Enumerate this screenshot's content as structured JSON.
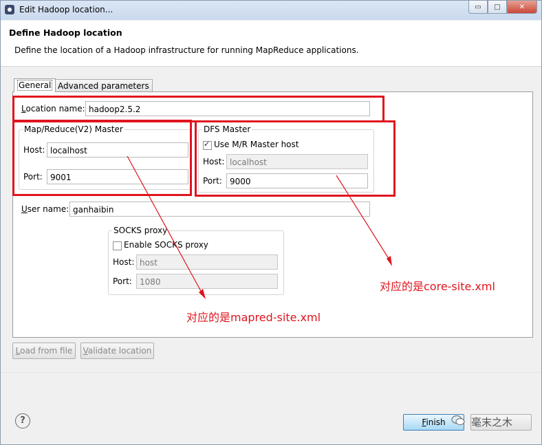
{
  "window": {
    "title": "Edit Hadoop location...",
    "buttons": {
      "minimize": "▭",
      "maximize": "□",
      "close": "✕"
    }
  },
  "header": {
    "title": "Define Hadoop location",
    "description": "Define the location of a Hadoop infrastructure for running MapReduce applications."
  },
  "tabs": [
    {
      "label": "General",
      "selected": true
    },
    {
      "label": "Advanced parameters",
      "selected": false
    }
  ],
  "general": {
    "location_name": {
      "label_accel": "L",
      "label_rest": "ocation name:",
      "value": "hadoop2.5.2"
    },
    "mapred_master": {
      "title": "Map/Reduce(V2) Master",
      "host_label": "Host:",
      "host_value": "localhost",
      "port_label": "Port:",
      "port_value": "9001"
    },
    "dfs_master": {
      "title": "DFS Master",
      "use_mr_label": "Use M/R Master host",
      "use_mr_checked": true,
      "host_label": "Host:",
      "host_value": "localhost",
      "port_label": "Port:",
      "port_value": "9000"
    },
    "user_name": {
      "label_accel": "U",
      "label_rest": "ser name:",
      "value": "ganhaibin"
    },
    "socks": {
      "title": "SOCKS proxy",
      "enable_label": "Enable SOCKS proxy",
      "enable_checked": false,
      "host_label": "Host:",
      "host_value": "host",
      "port_label": "Port:",
      "port_value": "1080"
    }
  },
  "annotations": {
    "dfs": "对应的是core-site.xml",
    "mapred": "对应的是mapred-site.xml",
    "color": "#e0141e"
  },
  "buttons": {
    "load_accel": "L",
    "load_rest": "oad from file",
    "validate_accel": "V",
    "validate_rest": "alidate location",
    "finish_accel": "F",
    "finish_rest": "inish",
    "help": "?"
  },
  "watermark": {
    "text": "毫末之木",
    "icon": "wechat-icon"
  }
}
